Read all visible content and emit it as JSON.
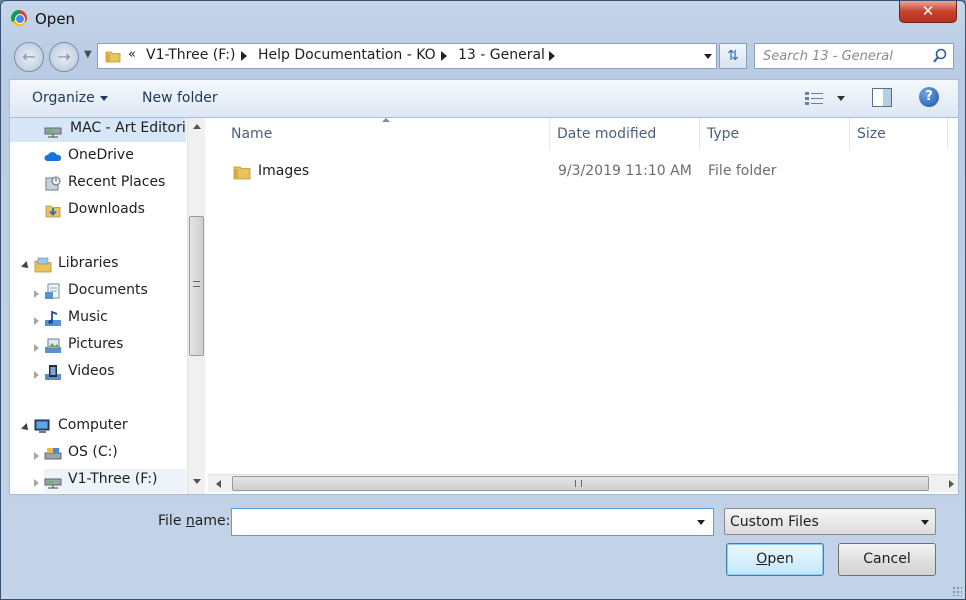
{
  "window": {
    "title": "Open",
    "close_symbol": "✕"
  },
  "address": {
    "overflow": "«",
    "crumbs": [
      "V1-Three (F:)",
      "Help Documentation - KO",
      "13 - General"
    ]
  },
  "search": {
    "placeholder": "Search 13 - General"
  },
  "commandbar": {
    "organize": "Organize",
    "new_folder": "New folder",
    "help": "?"
  },
  "nav": {
    "items": [
      {
        "label": "MAC - Art Editorial",
        "icon": "network-drive-icon"
      },
      {
        "label": "OneDrive",
        "icon": "onedrive-icon"
      },
      {
        "label": "Recent Places",
        "icon": "recent-places-icon"
      },
      {
        "label": "Downloads",
        "icon": "downloads-icon"
      },
      {
        "label": "Libraries",
        "icon": "libraries-icon"
      },
      {
        "label": "Documents",
        "icon": "documents-icon"
      },
      {
        "label": "Music",
        "icon": "music-icon"
      },
      {
        "label": "Pictures",
        "icon": "pictures-icon"
      },
      {
        "label": "Videos",
        "icon": "videos-icon"
      },
      {
        "label": "Computer",
        "icon": "computer-icon"
      },
      {
        "label": "OS (C:)",
        "icon": "drive-icon"
      },
      {
        "label": "V1-Three (F:)",
        "icon": "network-drive-icon"
      }
    ]
  },
  "columns": {
    "name": "Name",
    "date": "Date modified",
    "type": "Type",
    "size": "Size"
  },
  "files": [
    {
      "name": "Images",
      "date": "9/3/2019 11:10 AM",
      "type": "File folder",
      "size": ""
    }
  ],
  "footer": {
    "filename_label_pre": "File ",
    "filename_label_u": "n",
    "filename_label_post": "ame:",
    "filename_value": "",
    "filter_value": "Custom Files",
    "open_u": "O",
    "open_rest": "pen",
    "cancel": "Cancel"
  },
  "colors": {
    "accent": "#1e395b",
    "selection": "#d7e7f8",
    "close": "#c7422d"
  }
}
